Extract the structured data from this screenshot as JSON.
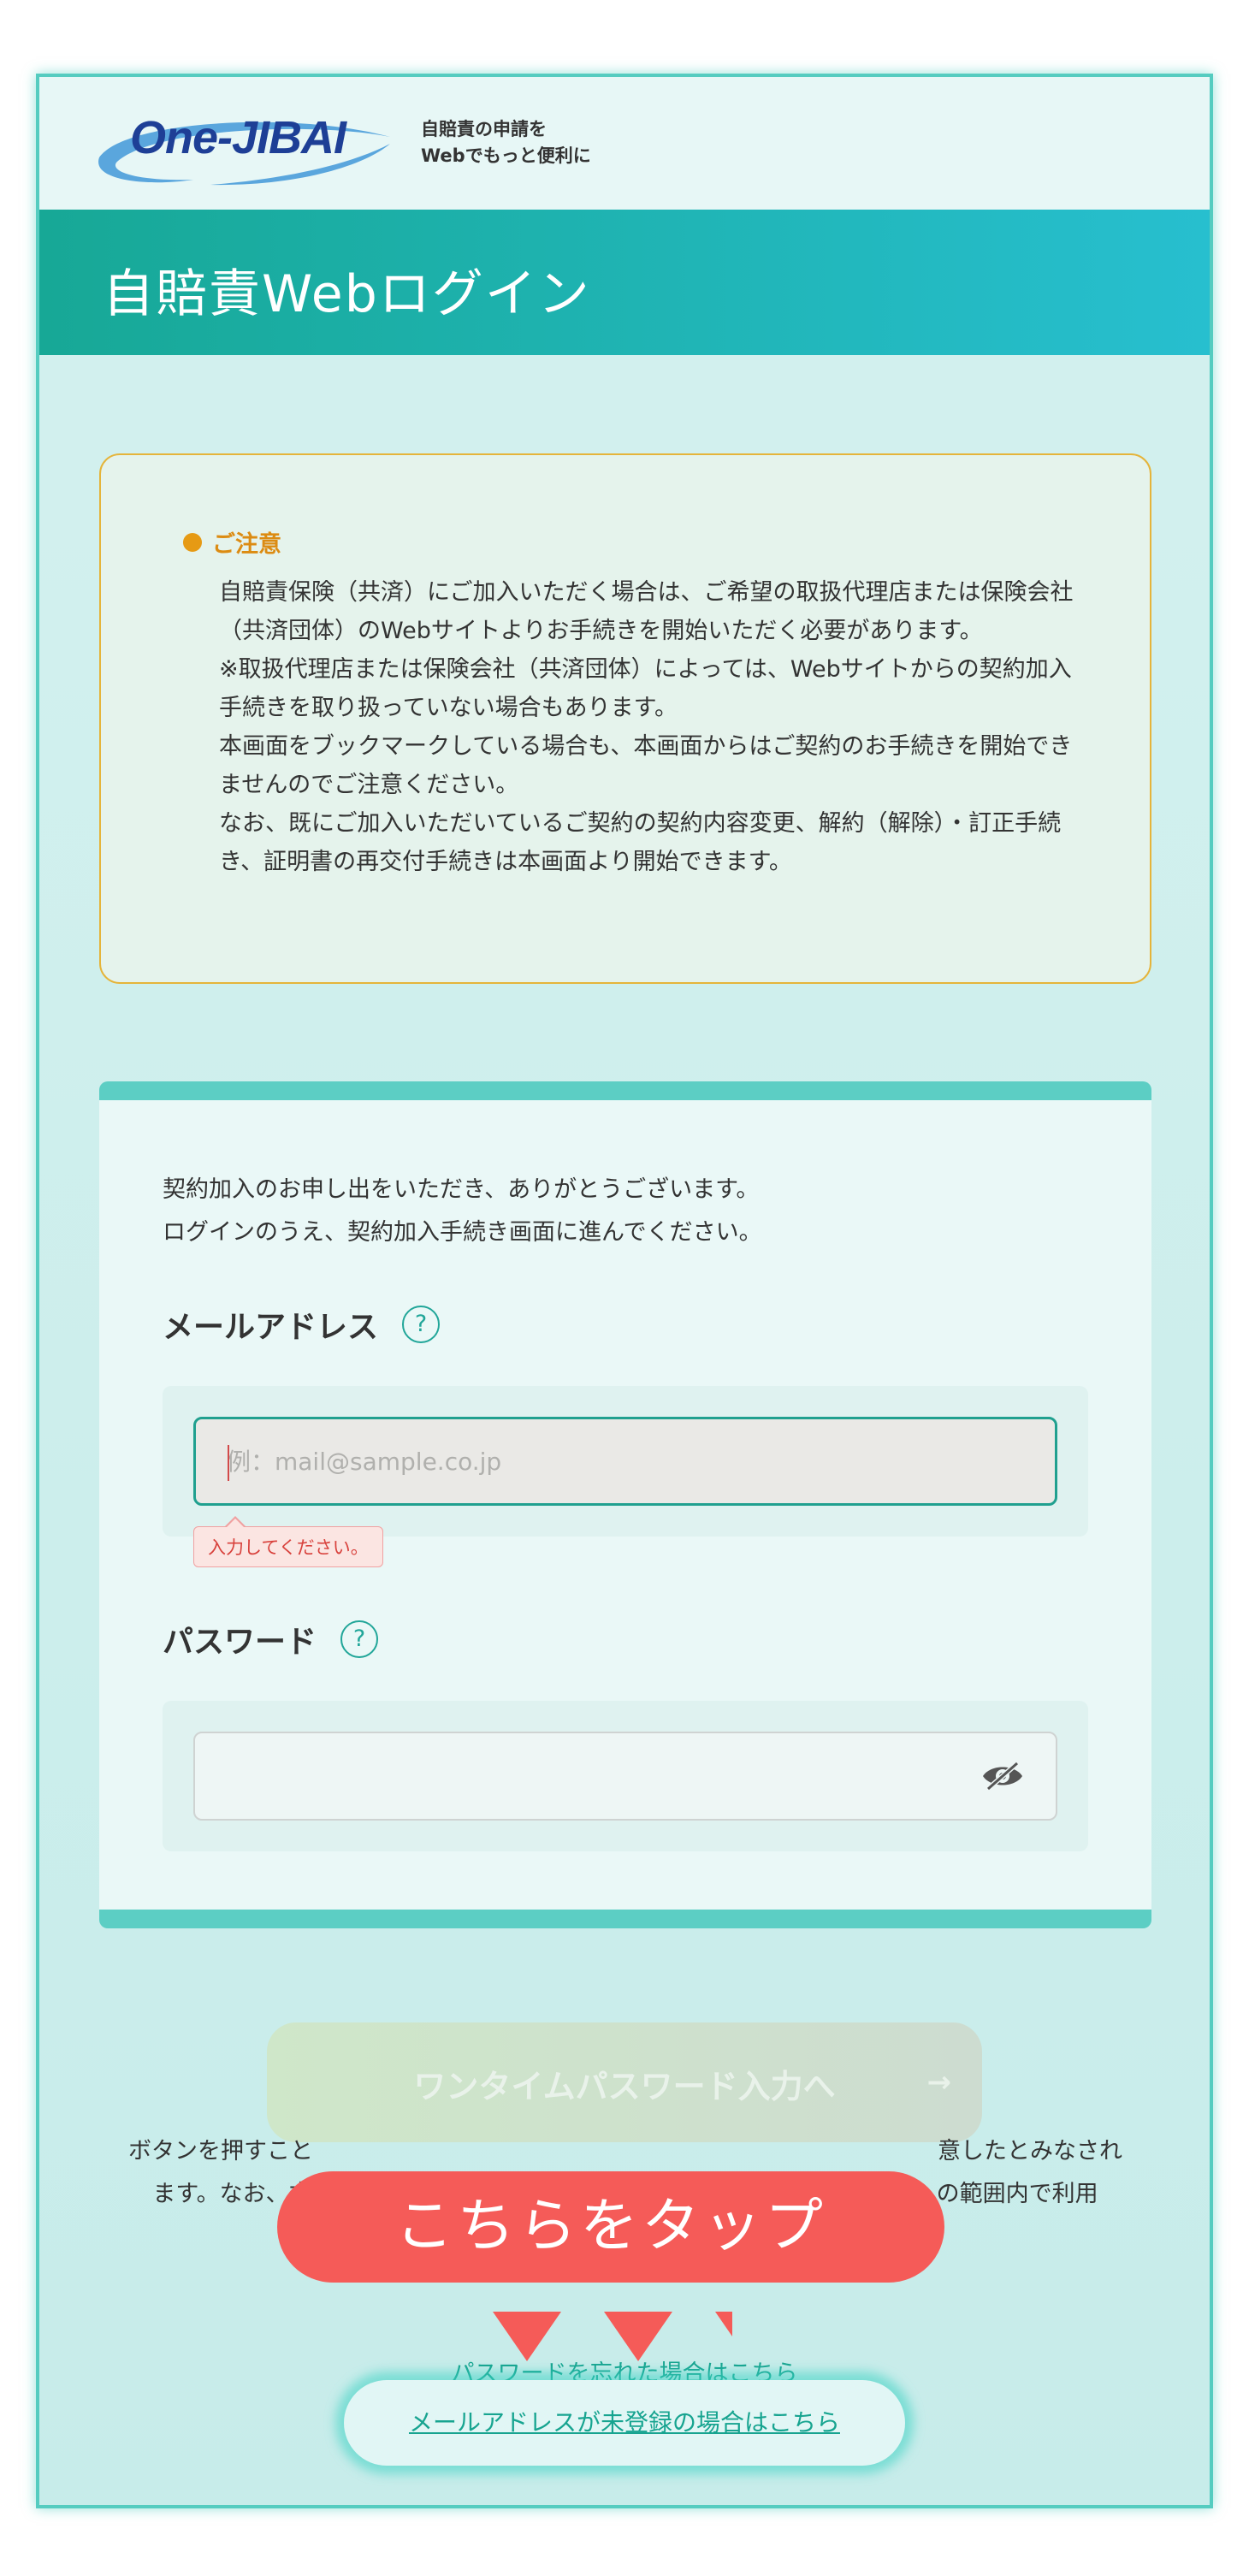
{
  "header": {
    "logo_text": "One-JIBAI",
    "tagline_line1": "自賠責の申請を",
    "tagline_line2": "Webでもっと便利に"
  },
  "page_title": "自賠責Webログイン",
  "notice": {
    "title": "ご注意",
    "paragraphs": [
      "自賠責保険（共済）にご加入いただく場合は、ご希望の取扱代理店または保険会社（共済団体）のWebサイトよりお手続きを開始いただく必要があります。",
      "※取扱代理店または保険会社（共済団体）によっては、Webサイトからの契約加入手続きを取り扱っていない場合もあります。",
      "本画面をブックマークしている場合も、本画面からはご契約のお手続きを開始できませんのでご注意ください。",
      "なお、既にご加入いただいているご契約の契約内容変更、解約（解除）・訂正手続き、証明書の再交付手続きは本画面より開始できます。"
    ]
  },
  "form": {
    "intro_line1": "契約加入のお申し出をいただき、ありがとうございます。",
    "intro_line2": "ログインのうえ、契約加入手続き画面に進んでください。",
    "email_label": "メールアドレス",
    "email_placeholder": "例：mail@sample.co.jp",
    "email_value": "",
    "email_error": "入力してください。",
    "password_label": "パスワード",
    "password_value": "",
    "help_glyph": "?"
  },
  "icons": {
    "help": "question-circle-icon",
    "password_toggle": "eye-slash-icon",
    "next": "arrow-right-icon"
  },
  "primary_button": {
    "label": "ワンタイムパスワード入力へ",
    "arrow": "→"
  },
  "agreement": {
    "line1_left": "ボタンを押すこと",
    "line1_right": "意したとみなされ",
    "line2_left": "ます。なお、本",
    "line2_right": "の範囲内で利用"
  },
  "links": {
    "forgot_password": "パスワードを忘れた場合はこちら",
    "email_unregistered": "メールアドレスが未登録の場合はこちら"
  },
  "overlay": {
    "tap_banner": "こちらをタップ"
  },
  "colors": {
    "accent": "#17a896",
    "notice_border": "#e5b43a",
    "banner": "#f55b58",
    "error": "#d8413c"
  }
}
